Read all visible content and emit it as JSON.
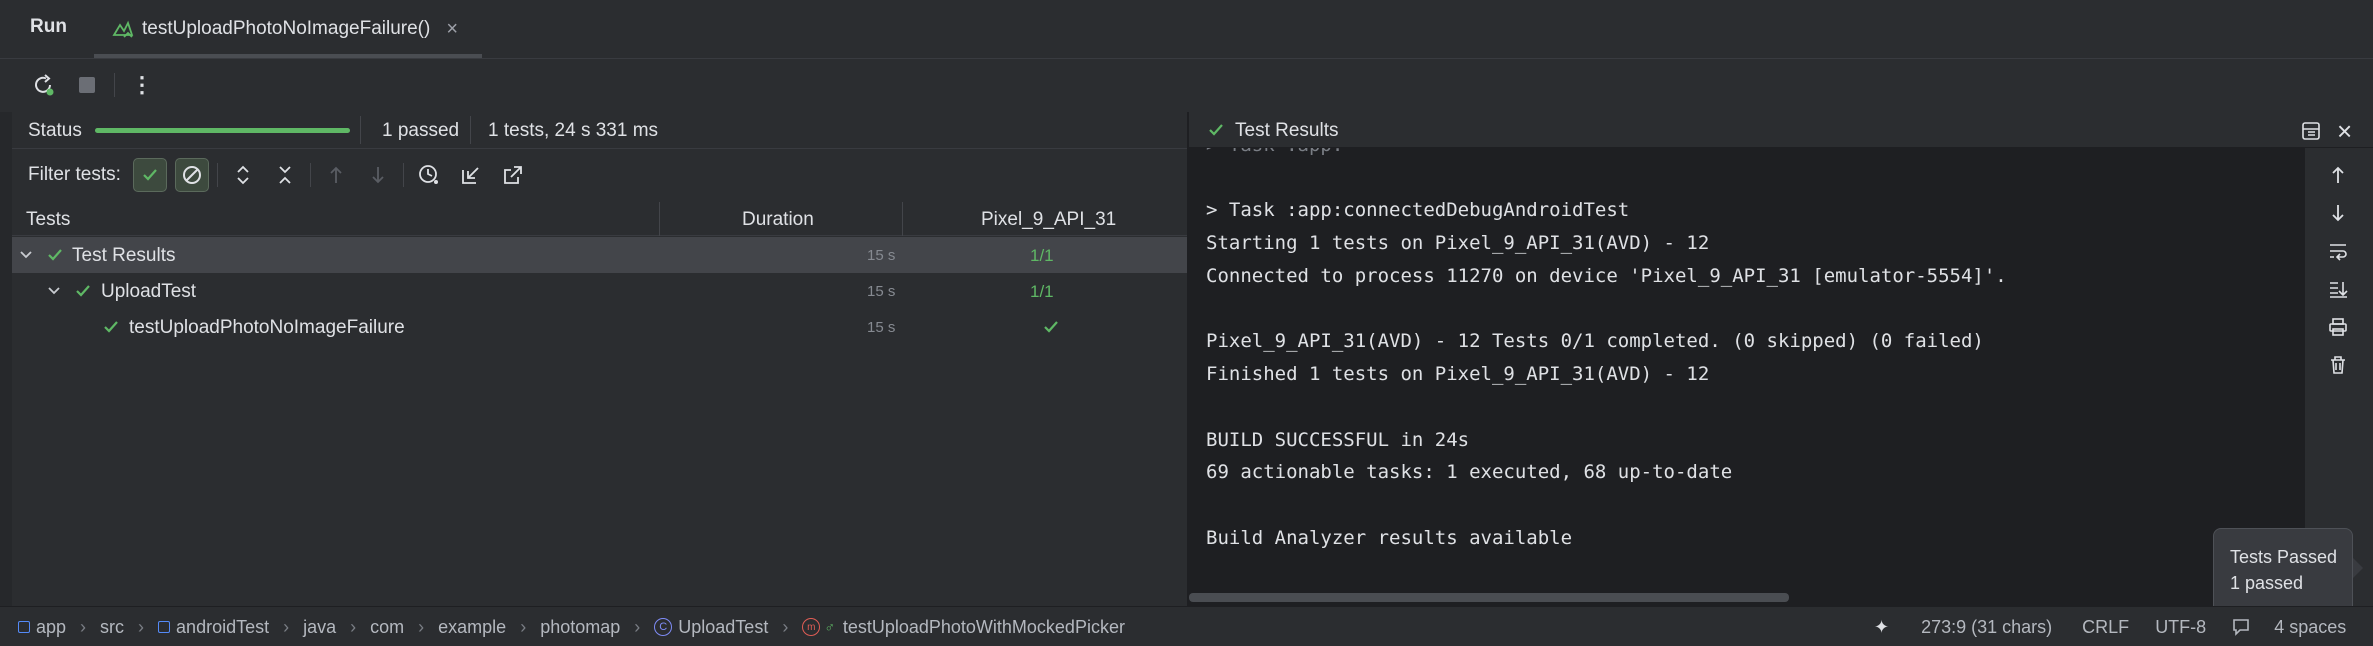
{
  "run_panel": {
    "title": "Run",
    "tab_label": "testUploadPhotoNoImageFailure()"
  },
  "status_bar": {
    "label": "Status",
    "progress": 1.0,
    "passed": "1 passed",
    "summary": "1 tests, 24 s 331 ms"
  },
  "filter": {
    "label": "Filter tests:"
  },
  "tree": {
    "headers": {
      "tests": "Tests",
      "duration": "Duration",
      "device": "Pixel_9_API_31"
    },
    "rows": [
      {
        "name": "Test Results",
        "duration": "15 s",
        "device": "1/1"
      },
      {
        "name": "UploadTest",
        "duration": "15 s",
        "device": "1/1"
      },
      {
        "name": "testUploadPhotoNoImageFailure",
        "duration": "15 s",
        "device": ""
      }
    ]
  },
  "console": {
    "title": "Test Results",
    "lines": [
      "> Task :app:connectedDebugAndroidTest",
      "Starting 1 tests on Pixel_9_API_31(AVD) - 12",
      "Connected to process 11270 on device 'Pixel_9_API_31 [emulator-5554]'.",
      "",
      "Pixel_9_API_31(AVD) - 12 Tests 0/1 completed. (0 skipped) (0 failed)",
      "Finished 1 tests on Pixel_9_API_31(AVD) - 12",
      "",
      "BUILD SUCCESSFUL in 24s",
      "69 actionable tasks: 1 executed, 68 up-to-date",
      "",
      "Build Analyzer results available"
    ]
  },
  "notification": {
    "title": "Tests Passed",
    "body": "1 passed"
  },
  "breadcrumb": [
    "app",
    "src",
    "androidTest",
    "java",
    "com",
    "example",
    "photomap",
    "UploadTest",
    "testUploadPhotoWithMockedPicker"
  ],
  "footer": {
    "position": "273:9 (31 chars)",
    "line_ending": "CRLF",
    "encoding": "UTF-8",
    "indent": "4 spaces"
  },
  "colors": {
    "accent_green": "#5fb865",
    "bg_panel": "#2b2d30",
    "bg_console": "#1e1f22",
    "text": "#dfe1e5",
    "muted": "#868a91"
  }
}
